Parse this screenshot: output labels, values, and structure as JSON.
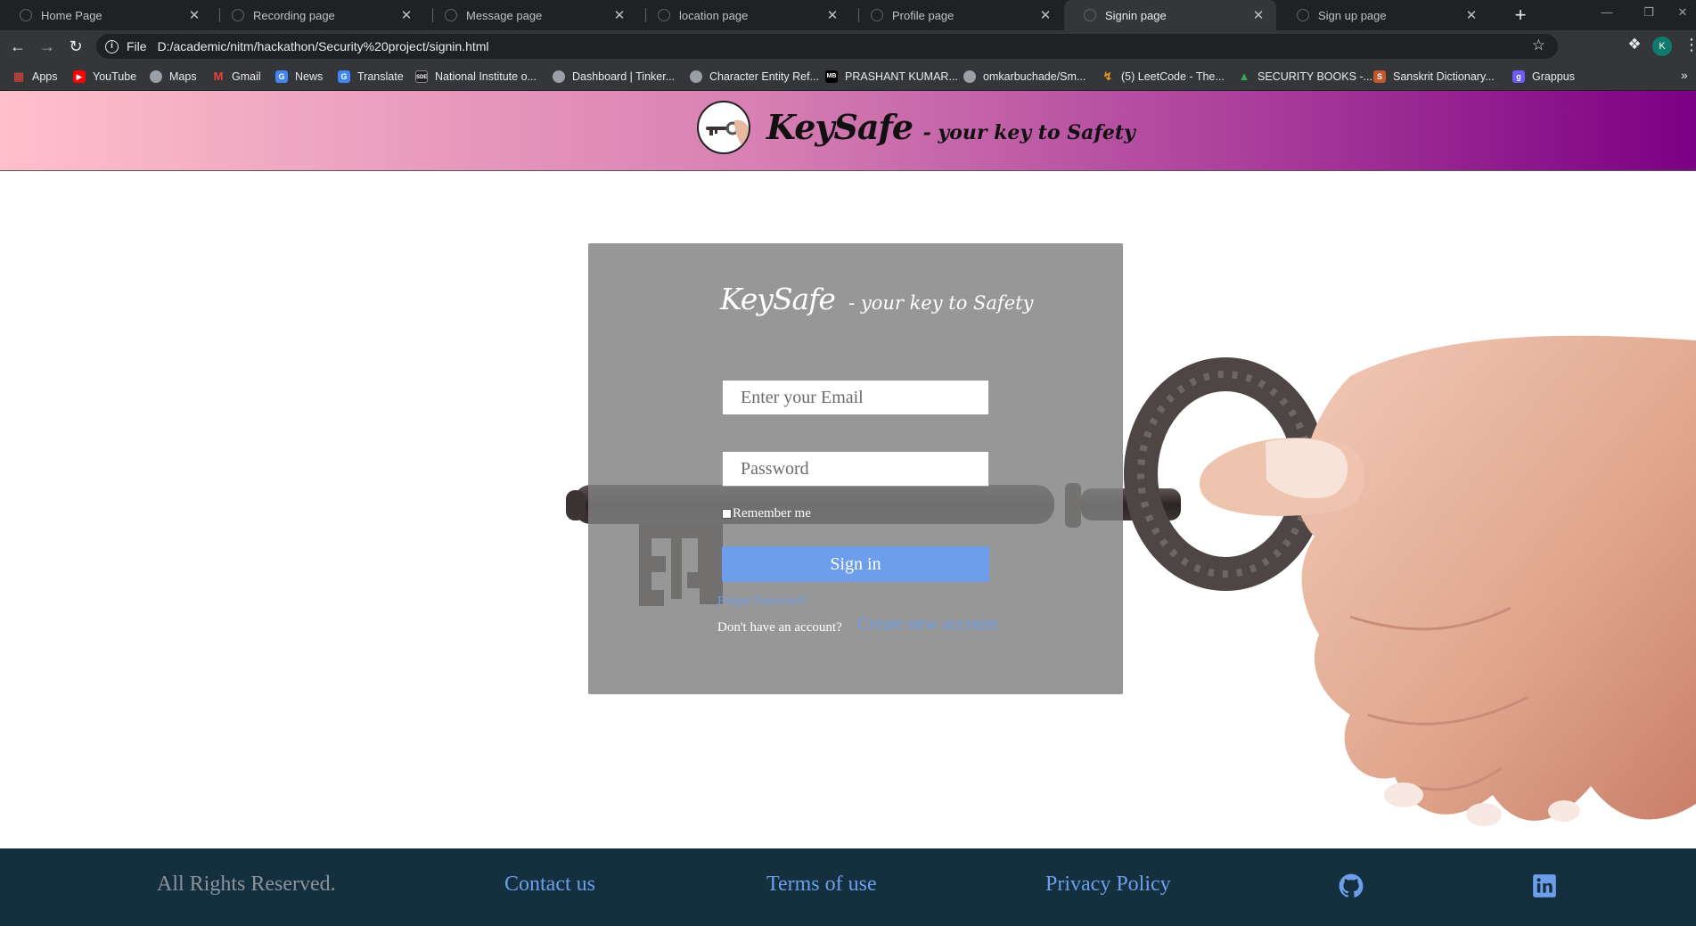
{
  "browser": {
    "tabs": [
      {
        "title": "Home Page",
        "active": false
      },
      {
        "title": "Recording page",
        "active": false
      },
      {
        "title": "Message page",
        "active": false
      },
      {
        "title": "location page",
        "active": false
      },
      {
        "title": "Profile page",
        "active": false
      },
      {
        "title": "Signin page",
        "active": true
      },
      {
        "title": "Sign up page",
        "active": false
      }
    ],
    "tab_close_glyph": "✕",
    "new_tab_glyph": "+",
    "address": {
      "scheme_label": "File",
      "url": "D:/academic/nitm/hackathon/Security%20project/signin.html"
    },
    "profile_initial": "K",
    "bookmarks": [
      {
        "label": "Apps",
        "icon": "apps-grid-icon",
        "color": "#e8453c"
      },
      {
        "label": "YouTube",
        "icon": "youtube-icon",
        "color": "#ff0000"
      },
      {
        "label": "Maps",
        "icon": "globe-icon",
        "color": "#9aa0a6"
      },
      {
        "label": "Gmail",
        "icon": "gmail-icon",
        "color": "#ea4335"
      },
      {
        "label": "News",
        "icon": "news-icon",
        "color": "#4285f4"
      },
      {
        "label": "Translate",
        "icon": "translate-icon",
        "color": "#4285f4"
      },
      {
        "label": "National Institute o...",
        "icon": "institute-icon",
        "color": "#202124"
      },
      {
        "label": "Dashboard | Tinker...",
        "icon": "globe-icon",
        "color": "#9aa0a6"
      },
      {
        "label": "Character Entity Ref...",
        "icon": "globe-icon",
        "color": "#9aa0a6"
      },
      {
        "label": "PRASHANT KUMAR...",
        "icon": "mb-icon",
        "color": "#000000"
      },
      {
        "label": "omkarbuchade/Sm...",
        "icon": "globe-icon",
        "color": "#9aa0a6"
      },
      {
        "label": "(5) LeetCode - The...",
        "icon": "leetcode-icon",
        "color": "#f89f1b"
      },
      {
        "label": "SECURITY BOOKS -...",
        "icon": "drive-icon",
        "color": "#34a853"
      },
      {
        "label": "Sanskrit Dictionary...",
        "icon": "dictionary-icon",
        "color": "#c0582c"
      },
      {
        "label": "Grappus",
        "icon": "grappus-icon",
        "color": "#6a5cf5"
      }
    ]
  },
  "header": {
    "brand_name": "KeySafe",
    "tagline": "- your key to Safety"
  },
  "signin": {
    "brand_name": "KeySafe",
    "tagline": "- your key to Safety",
    "email_placeholder": "Enter your Email",
    "password_placeholder": "Password",
    "remember_label": "Remember me",
    "submit_label": "Sign in",
    "forgot_label": "Forgot Password?",
    "no_account_label": "Don't have an account?",
    "create_account_label": "Create new account"
  },
  "footer": {
    "rights": "All Rights Reserved.",
    "contact": "Contact us",
    "terms": "Terms of use",
    "privacy": "Privacy Policy",
    "github_icon": "github-icon",
    "linkedin_icon": "linkedin-icon"
  },
  "colors": {
    "header_gradient_start": "#ffc0cb",
    "header_gradient_end": "#7b0083",
    "card_background": "#808080",
    "link_accent": "#6d9eeb",
    "footer_background": "#14303f"
  }
}
